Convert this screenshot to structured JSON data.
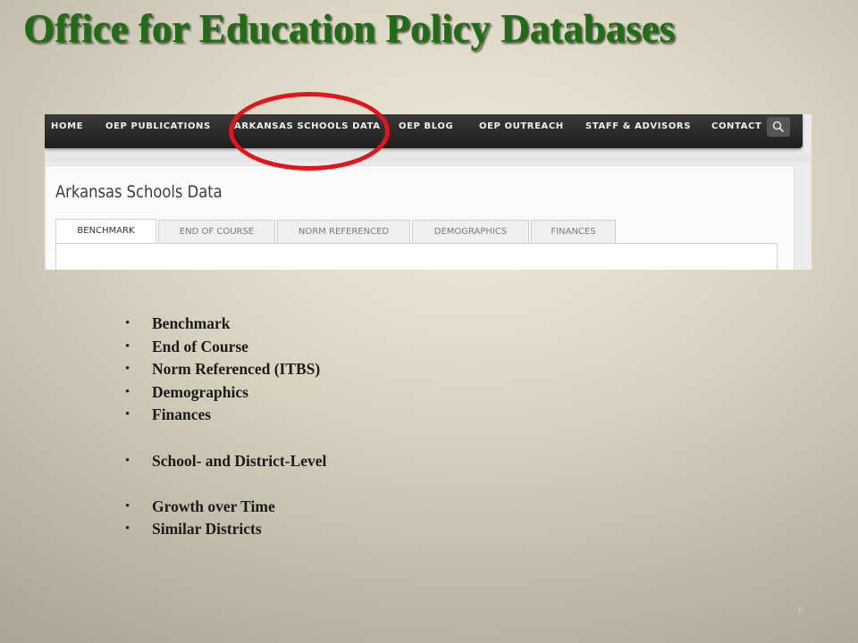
{
  "slide": {
    "title": "Office for Education Policy Databases",
    "slide_number": "6"
  },
  "website": {
    "nav": {
      "items": [
        "HOME",
        "OEP PUBLICATIONS",
        "ARKANSAS SCHOOLS DATA",
        "OEP BLOG",
        "OEP OUTREACH",
        "STAFF & ADVISORS",
        "CONTACT"
      ],
      "search_icon": "search-icon",
      "highlighted_item": "ARKANSAS SCHOOLS DATA"
    },
    "page_heading": "Arkansas Schools Data",
    "tabs": [
      "BENCHMARK",
      "END OF COURSE",
      "NORM REFERENCED",
      "DEMOGRAPHICS",
      "FINANCES"
    ],
    "active_tab": "BENCHMARK"
  },
  "highlight_color": "#e3141c",
  "title_color": "#1f6e16",
  "bullets": [
    "Benchmark",
    "End of Course",
    "Norm Referenced  (ITBS)",
    "Demographics",
    "Finances",
    "School- and District-Level",
    "Growth over Time",
    "Similar Districts"
  ]
}
